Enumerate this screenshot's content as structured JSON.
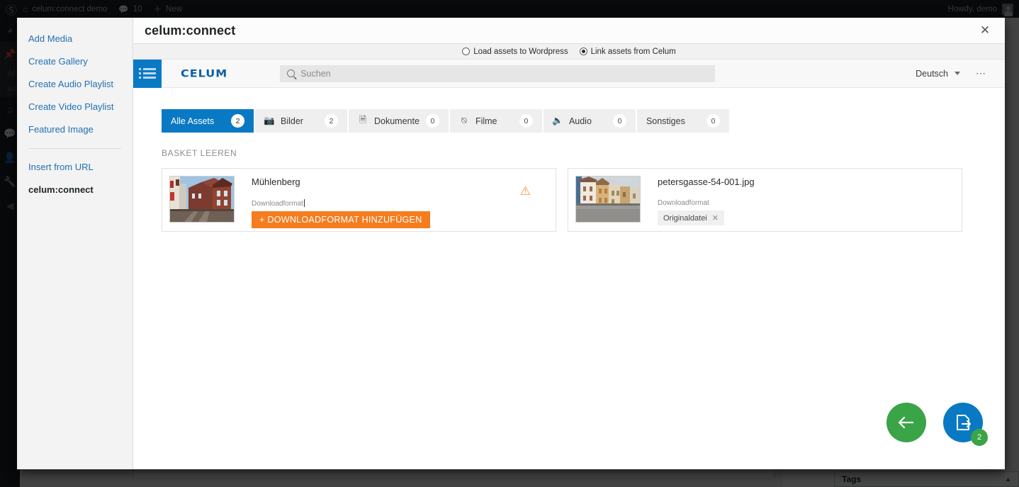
{
  "adminbar": {
    "logo_icon": "wordpress-logo-icon",
    "site_name": "celum:connect demo",
    "comments_count": "10",
    "new_label": "New",
    "howdy": "Howdy, demo"
  },
  "wp_sidebar": {
    "submenu": [
      {
        "label": "All"
      },
      {
        "label": "Add"
      }
    ],
    "icons": [
      "dashboard-icon",
      "pin-icon",
      "media-icon",
      "comments-icon",
      "users-icon",
      "tools-icon",
      "collapse-icon"
    ]
  },
  "behind": {
    "tags_metabox_title": "Tags"
  },
  "modal": {
    "title": "celum:connect",
    "close_label": "✕"
  },
  "media_menu": {
    "items": [
      {
        "label": "Add Media",
        "bold": false
      },
      {
        "label": "Create Gallery",
        "bold": false
      },
      {
        "label": "Create Audio Playlist",
        "bold": false
      },
      {
        "label": "Create Video Playlist",
        "bold": false
      },
      {
        "label": "Featured Image",
        "bold": false
      },
      {
        "label": "Insert from URL",
        "bold": false
      },
      {
        "label": "celum:connect",
        "bold": true
      }
    ]
  },
  "mode_switch": {
    "options": [
      {
        "label": "Load assets to Wordpress",
        "selected": false
      },
      {
        "label": "Link assets from Celum",
        "selected": true
      }
    ]
  },
  "celum_header": {
    "menu_icon": "hamburger-list-icon",
    "logo_text": "CELUM",
    "search_placeholder": "Suchen",
    "search_value": "",
    "search_icon": "search-icon",
    "language": "Deutsch",
    "more_icon": "ellipsis-icon"
  },
  "tabs": [
    {
      "label": "Alle Assets",
      "count": "2",
      "icon": "",
      "active": true
    },
    {
      "label": "Bilder",
      "count": "2",
      "icon": "image-icon",
      "active": false
    },
    {
      "label": "Dokumente",
      "count": "0",
      "icon": "document-icon",
      "active": false
    },
    {
      "label": "Filme",
      "count": "0",
      "icon": "play-circle-icon",
      "active": false
    },
    {
      "label": "Audio",
      "count": "0",
      "icon": "speaker-icon",
      "active": false
    },
    {
      "label": "Sonstiges",
      "count": "0",
      "icon": "",
      "active": false
    }
  ],
  "basket": {
    "clear_label": "BASKET LEEREN",
    "cards": [
      {
        "title": "Mühlenberg",
        "download_label": "Downloadformat",
        "has_caret": true,
        "action_label": "+ DOWNLOADFORMAT HINZUFÜGEN",
        "warning_icon": "warning-triangle-icon",
        "thumbnail": "street-houses-thumbnail"
      },
      {
        "title": "petersgasse-54-001.jpg",
        "download_label": "Downloadformat",
        "has_caret": false,
        "chip_label": "Originaldatei",
        "chip_remove": "✕",
        "thumbnail": "street-facades-thumbnail"
      }
    ]
  },
  "fabs": {
    "back_icon": "arrow-left-icon",
    "export_icon": "document-export-icon",
    "badge_count": "2"
  },
  "colors": {
    "celum_blue": "#0a79c4",
    "orange": "#f57c1f",
    "green": "#3aa446",
    "warning": "#f79445",
    "wp_link": "#2271b1"
  }
}
